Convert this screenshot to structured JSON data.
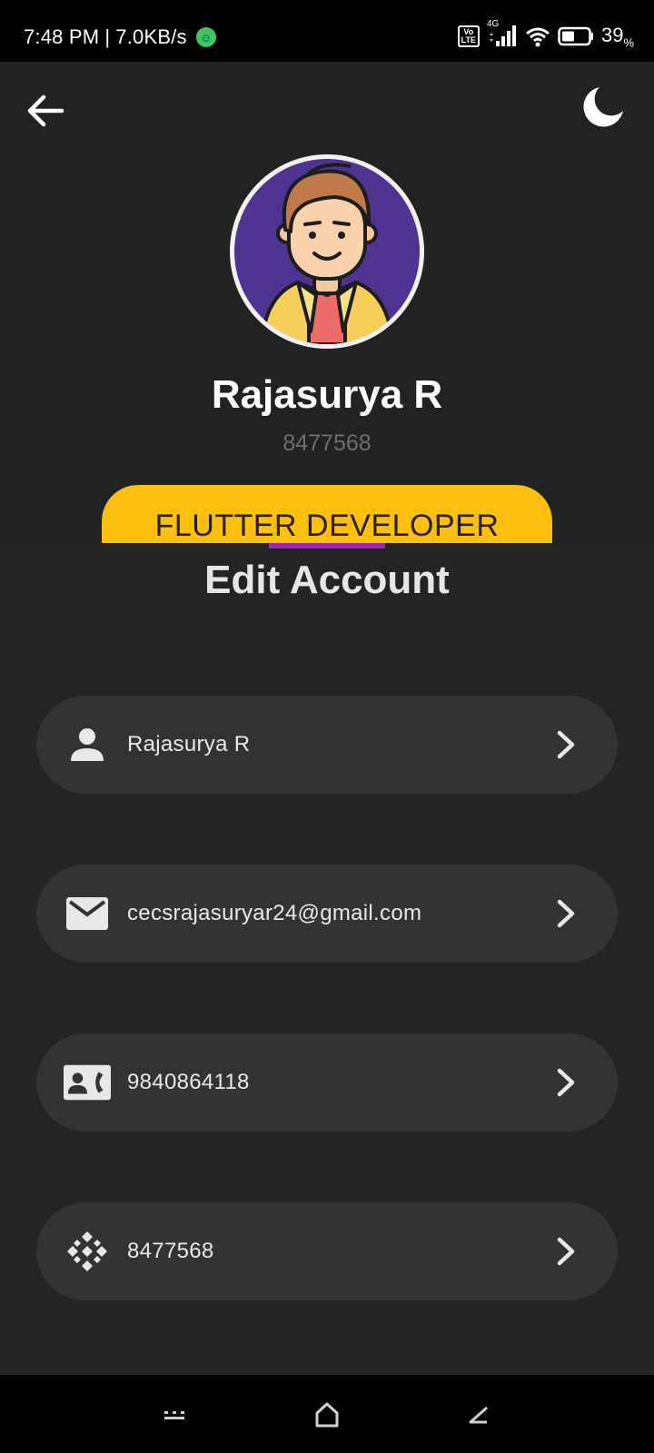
{
  "status_bar": {
    "time": "7:48 PM",
    "separator": "|",
    "net_speed": "7.0KB/s",
    "volte_top": "Vo",
    "volte_bottom": "LTE",
    "network_type": "4G",
    "battery_percent": "39",
    "battery_unit": "%"
  },
  "header": {
    "user_name": "Rajasurya R",
    "user_id": "8477568",
    "role": "FLUTTER DEVELOPER"
  },
  "main": {
    "title": "Edit Account",
    "fields": [
      {
        "icon": "person-icon",
        "value": "Rajasurya R"
      },
      {
        "icon": "mail-icon",
        "value": "cecsrajasuryar24@gmail.com"
      },
      {
        "icon": "contact-phone-icon",
        "value": "9840864118"
      },
      {
        "icon": "id-pattern-icon",
        "value": "8477568"
      }
    ]
  },
  "colors": {
    "accent_yellow": "#fbbf0d",
    "tab_indicator": "#9c27b0",
    "avatar_bg": "#4f3391",
    "surface": "#242424",
    "field_bg": "#333333"
  }
}
